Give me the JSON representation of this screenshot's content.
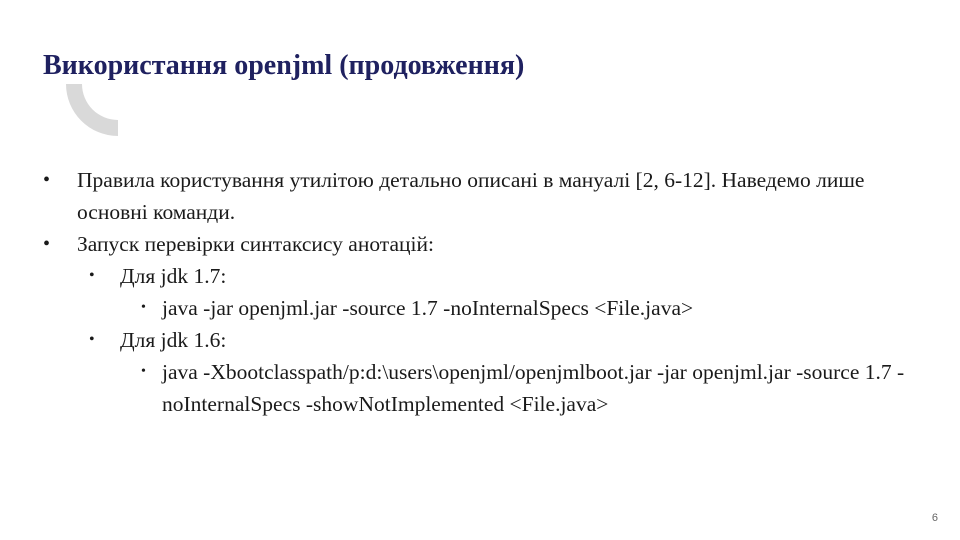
{
  "slide": {
    "title": "Використання openjml (продовження)",
    "page_number": "6",
    "accent_color": "#1f2160",
    "decoration_color": "#d9d9d9",
    "bullets": [
      {
        "text": "Правила користування утилітою детально описані в мануалі [2, 6-12]. Наведемо лише основні команди."
      },
      {
        "text": "Запуск перевірки синтаксису анотацій:",
        "children": [
          {
            "text": "Для jdk 1.7:",
            "children": [
              {
                "text": "java -jar openjml.jar -source 1.7 -noInternalSpecs <File.java>"
              }
            ]
          },
          {
            "text": "Для jdk 1.6:",
            "children": [
              {
                "text": "java -Xbootclasspath/p:d:\\users\\openjml/openjmlboot.jar -jar openjml.jar -source 1.7 -noInternalSpecs -showNotImplemented <File.java>"
              }
            ]
          }
        ]
      }
    ]
  }
}
